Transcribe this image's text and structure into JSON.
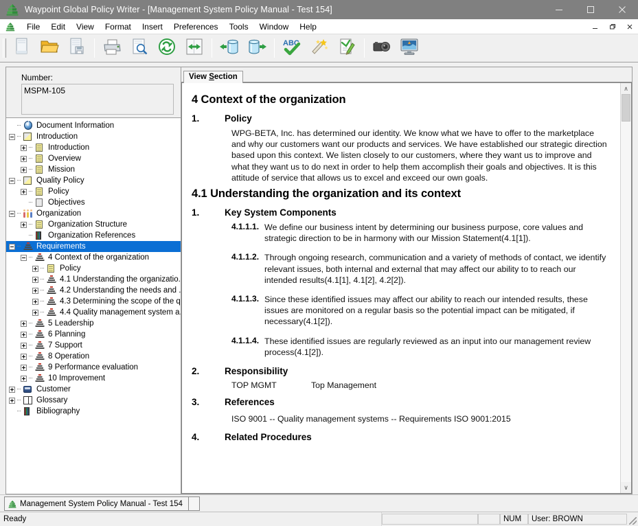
{
  "window": {
    "title": "Waypoint Global Policy Writer - [Management System Policy Manual - Test 154]",
    "app_icon": "pyramid-icon",
    "minimize_label": "–",
    "maximize_label": "□",
    "close_label": "✕"
  },
  "menubar": {
    "items": [
      {
        "label": "File"
      },
      {
        "label": "Edit"
      },
      {
        "label": "View"
      },
      {
        "label": "Format"
      },
      {
        "label": "Insert"
      },
      {
        "label": "Preferences"
      },
      {
        "label": "Tools"
      },
      {
        "label": "Window"
      },
      {
        "label": "Help"
      }
    ],
    "mdi_minimize": "_",
    "mdi_restore": "❐",
    "mdi_close": "✕"
  },
  "toolbar": {
    "buttons": [
      {
        "name": "new-document-icon",
        "title": "New"
      },
      {
        "name": "open-folder-icon",
        "title": "Open"
      },
      {
        "name": "save-document-icon",
        "title": "Save"
      },
      {
        "name": "print-icon",
        "title": "Print"
      },
      {
        "name": "print-preview-icon",
        "title": "Print Preview"
      },
      {
        "name": "refresh-icon",
        "title": "Refresh"
      },
      {
        "name": "swap-arrows-icon",
        "title": "Swap"
      },
      {
        "name": "import-database-icon",
        "title": "Import"
      },
      {
        "name": "export-database-icon",
        "title": "Export"
      },
      {
        "name": "spell-check-icon",
        "title": "Spell Check"
      },
      {
        "name": "magic-wand-icon",
        "title": "Wizard"
      },
      {
        "name": "edit-checklist-icon",
        "title": "Edit Checklist"
      },
      {
        "name": "camera-icon",
        "title": "Capture"
      },
      {
        "name": "monitor-icon",
        "title": "Display"
      }
    ]
  },
  "left_pane": {
    "number_label": "Number:",
    "number_value": "MSPM-105",
    "tree": [
      {
        "label": "Document Information",
        "depth": 0,
        "expander": "none",
        "icon": "info-icon",
        "selected": false
      },
      {
        "label": "Introduction",
        "depth": 0,
        "expander": "minus",
        "icon": "section-folder-icon",
        "selected": false
      },
      {
        "label": "Introduction",
        "depth": 1,
        "expander": "plus",
        "icon": "document-icon",
        "selected": false
      },
      {
        "label": "Overview",
        "depth": 1,
        "expander": "plus",
        "icon": "document-icon",
        "selected": false
      },
      {
        "label": "Mission",
        "depth": 1,
        "expander": "plus",
        "icon": "document-icon",
        "selected": false
      },
      {
        "label": "Quality Policy",
        "depth": 0,
        "expander": "minus",
        "icon": "section-folder-icon",
        "selected": false
      },
      {
        "label": "Policy",
        "depth": 1,
        "expander": "plus",
        "icon": "document-icon",
        "selected": false
      },
      {
        "label": "Objectives",
        "depth": 1,
        "expander": "none",
        "icon": "document-gray-icon",
        "selected": false
      },
      {
        "label": "Organization",
        "depth": 0,
        "expander": "minus",
        "icon": "people-icon",
        "selected": false
      },
      {
        "label": "Organization Structure",
        "depth": 1,
        "expander": "plus",
        "icon": "document-icon",
        "selected": false
      },
      {
        "label": "Organization References",
        "depth": 1,
        "expander": "none",
        "icon": "books-icon",
        "selected": false
      },
      {
        "label": "Requirements",
        "depth": 0,
        "expander": "minus",
        "icon": "pyramid-icon",
        "selected": true
      },
      {
        "label": "4 Context of the organization",
        "depth": 1,
        "expander": "minus",
        "icon": "pyramid-icon",
        "selected": false
      },
      {
        "label": "Policy",
        "depth": 2,
        "expander": "plus",
        "icon": "document-icon",
        "selected": false
      },
      {
        "label": "4.1 Understanding the organizatio...",
        "depth": 2,
        "expander": "plus",
        "icon": "pyramid-icon",
        "selected": false
      },
      {
        "label": "4.2 Understanding the needs and ...",
        "depth": 2,
        "expander": "plus",
        "icon": "pyramid-icon",
        "selected": false
      },
      {
        "label": "4.3 Determining the scope of the q...",
        "depth": 2,
        "expander": "plus",
        "icon": "pyramid-icon",
        "selected": false
      },
      {
        "label": "4.4 Quality management system a...",
        "depth": 2,
        "expander": "plus",
        "icon": "pyramid-icon",
        "selected": false
      },
      {
        "label": "5 Leadership",
        "depth": 1,
        "expander": "plus",
        "icon": "pyramid-icon",
        "selected": false
      },
      {
        "label": "6 Planning",
        "depth": 1,
        "expander": "plus",
        "icon": "pyramid-icon",
        "selected": false
      },
      {
        "label": "7 Support",
        "depth": 1,
        "expander": "plus",
        "icon": "pyramid-icon",
        "selected": false
      },
      {
        "label": "8 Operation",
        "depth": 1,
        "expander": "plus",
        "icon": "pyramid-icon",
        "selected": false
      },
      {
        "label": "9 Performance evaluation",
        "depth": 1,
        "expander": "plus",
        "icon": "pyramid-icon",
        "selected": false
      },
      {
        "label": "10 Improvement",
        "depth": 1,
        "expander": "plus",
        "icon": "pyramid-icon",
        "selected": false
      },
      {
        "label": "Customer",
        "depth": 0,
        "expander": "plus",
        "icon": "customer-icon",
        "selected": false
      },
      {
        "label": "Glossary",
        "depth": 0,
        "expander": "plus",
        "icon": "glossary-icon",
        "selected": false
      },
      {
        "label": "Bibliography",
        "depth": 0,
        "expander": "none",
        "icon": "books-icon",
        "selected": false
      }
    ]
  },
  "right_pane": {
    "tab_label_pre": "View ",
    "tab_label_accel": "S",
    "tab_label_post": "ection",
    "scrollbar": {
      "up_arrow": "∧",
      "down_arrow": "∨"
    },
    "document": {
      "heading1": "4 Context of the organization",
      "sections": [
        {
          "num": "1.",
          "title": "Policy",
          "paragraph": "WPG-BETA, Inc. has determined our identity. We know what we have to offer to the marketplace and why our customers want our products and services. We have established our strategic direction based upon this context. We listen closely to our customers, where they want us to improve and what they want us to do next in order to help them accomplish their goals and objectives. It is this attitude of service that allows us to excel and exceed our own goals."
        }
      ],
      "heading2": "4.1 Understanding the organization and its context",
      "section2_num": "1.",
      "section2_title": "Key System Components",
      "clauses": [
        {
          "num": "4.1.1.1.",
          "text": "We define our business intent by determining our business purpose, core values and strategic direction to be in harmony with our Mission Statement(4.1[1])."
        },
        {
          "num": "4.1.1.2.",
          "text": "Through ongoing research, communication and a variety of methods of contact, we identify relevant issues, both internal and external that may affect our ability to to reach our intended results(4.1[1], 4.1[2], 4.2[2])."
        },
        {
          "num": "4.1.1.3.",
          "text": "Since these identified issues may affect our ability to reach our intended results, these issues are monitored on a regular basis so the potential impact can be mitigated, if necessary(4.1[2])."
        },
        {
          "num": "4.1.1.4.",
          "text": "These identified issues are regularly reviewed as an input into our management review process(4.1[2])."
        }
      ],
      "responsibility_num": "2.",
      "responsibility_title": "Responsibility",
      "responsibility_code": "TOP MGMT",
      "responsibility_value": "Top Management",
      "references_num": "3.",
      "references_title": "References",
      "references_text": "ISO 9001 -- Quality management systems -- Requirements ISO 9001:2015",
      "related_num": "4.",
      "related_title": "Related Procedures"
    }
  },
  "mdi_taskbar": {
    "tab_label": "Management System Policy Manual - Test 154"
  },
  "statusbar": {
    "ready": "Ready",
    "field_blank_1": "",
    "field_blank_2": "",
    "num_indicator": "NUM",
    "user": "User: BROWN"
  },
  "colors": {
    "titlebar_bg": "#808080",
    "selection_blue": "#0b6fd4",
    "chrome_gray": "#f0f0f0",
    "accent_green": "#2e9a42"
  }
}
